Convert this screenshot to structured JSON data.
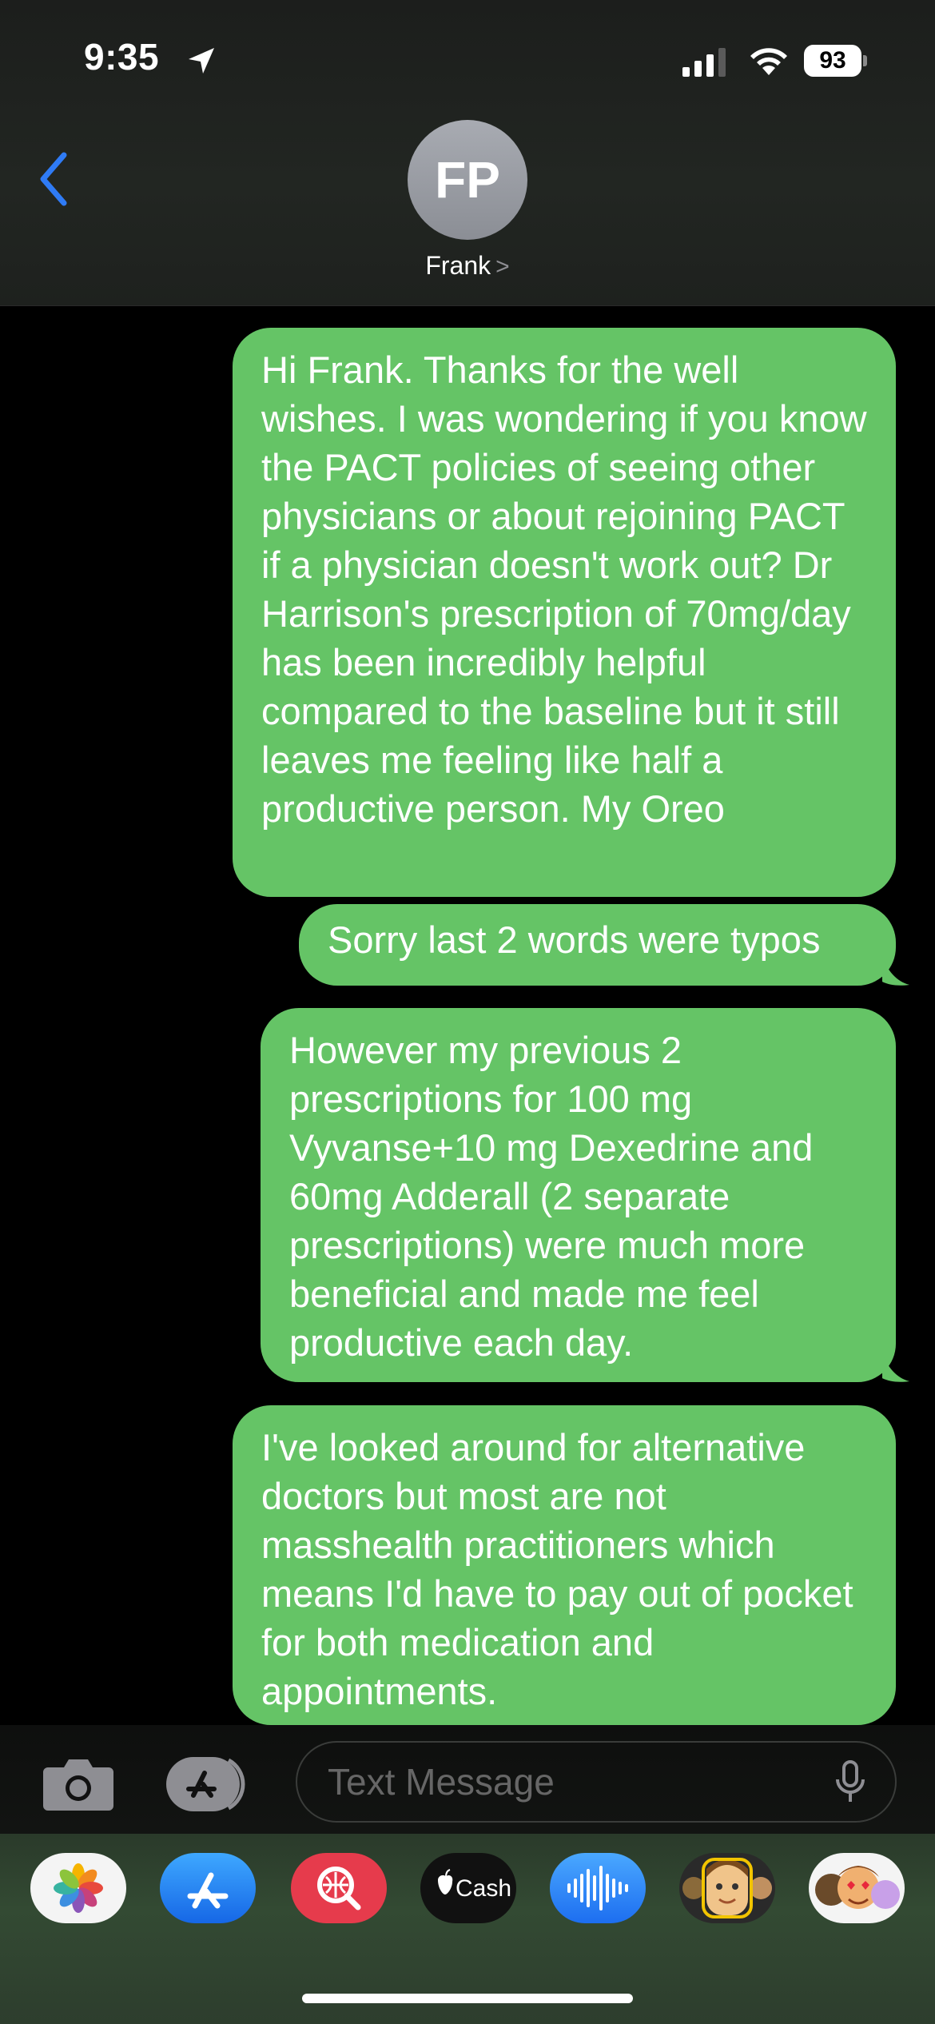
{
  "status_bar": {
    "time": "9:35",
    "battery": "93"
  },
  "header": {
    "avatar_initials": "FP",
    "contact_name": "Frank",
    "contact_chevron": ">"
  },
  "messages": [
    {
      "text": "Hi Frank. Thanks for the well wishes. I was wondering if you know the PACT policies of seeing other physicians or about rejoining PACT if a physician doesn't work out? Dr Harrison's prescription of 70mg/day has been incredibly helpful compared to the baseline but it still leaves me feeling like half a productive person. My Oreo"
    },
    {
      "text": "Sorry last 2 words were typos"
    },
    {
      "text": "However my previous 2 prescriptions for 100 mg Vyvanse+10 mg Dexedrine and 60mg Adderall (2 separate prescriptions) were much more beneficial and made me feel productive each day."
    },
    {
      "text": "I've looked around for alternative doctors but most are not masshealth practitioners which means I'd have to pay out of pocket for both medication and appointments."
    }
  ],
  "composer": {
    "placeholder": "Text Message"
  },
  "app_tray": {
    "apps": [
      {
        "name": "photos-app",
        "label": ""
      },
      {
        "name": "app-store-app",
        "label": ""
      },
      {
        "name": "search-images-app",
        "label": ""
      },
      {
        "name": "apple-cash-app",
        "label": "Cash"
      },
      {
        "name": "audio-message-app",
        "label": ""
      },
      {
        "name": "memoji-app",
        "label": ""
      },
      {
        "name": "memoji-stickers-app",
        "label": ""
      }
    ]
  },
  "colors": {
    "bubble": "#65c466",
    "accent": "#2f7bf5",
    "background": "#000000"
  }
}
